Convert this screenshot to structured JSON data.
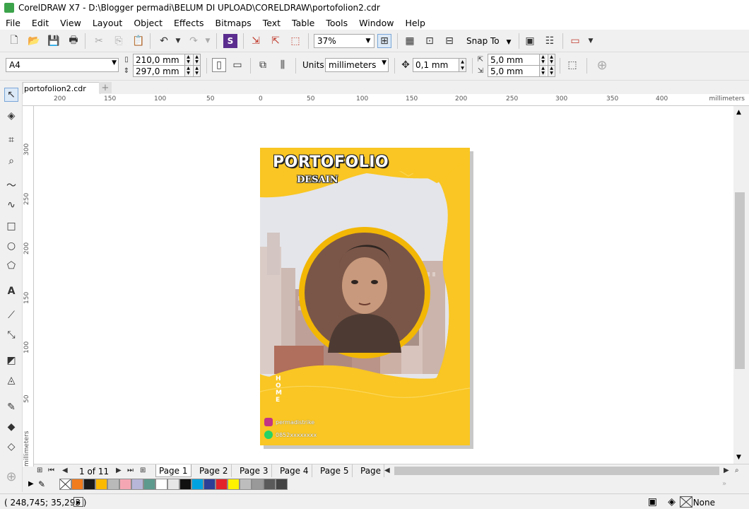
{
  "title_bar": {
    "app_title": "CorelDRAW X7 - D:\\Blogger permadi\\BELUM DI UPLOAD\\CORELDRAW\\portofolion2.cdr"
  },
  "menu": [
    "File",
    "Edit",
    "View",
    "Layout",
    "Object",
    "Effects",
    "Bitmaps",
    "Text",
    "Table",
    "Tools",
    "Window",
    "Help"
  ],
  "toolbar": {
    "zoom": "37%",
    "snap_to": "Snap To"
  },
  "property_bar": {
    "paper_size": "A4",
    "width": "210,0 mm",
    "height": "297,0 mm",
    "units_label": "Units:",
    "units": "millimeters",
    "nudge": "0,1 mm",
    "dup_x": "5,0 mm",
    "dup_y": "5,0 mm"
  },
  "document_tab": {
    "name": "portofolion2.cdr"
  },
  "ruler": {
    "h_ticks": [
      "200",
      "150",
      "100",
      "50",
      "0",
      "50",
      "100",
      "150",
      "200",
      "250",
      "300",
      "350",
      "400"
    ],
    "h_unit": "millimeters",
    "v_ticks": [
      "300",
      "250",
      "200",
      "150",
      "100",
      "50"
    ],
    "v_unit": "millimeters"
  },
  "poster": {
    "title": "PORTOFOLIO",
    "subtitle": "DESAIN",
    "side_text": "HOME",
    "instagram": "permadistrike",
    "whatsapp": "0852xxxxxxxx",
    "colors": {
      "yellow": "#f9c623",
      "sky": "#e8eaee",
      "accent": "#f2b705"
    }
  },
  "page_nav": {
    "counter": "1 of 11",
    "tabs": [
      "Page 1",
      "Page 2",
      "Page 3",
      "Page 4",
      "Page 5",
      "Page"
    ]
  },
  "palette": [
    "#ffffff",
    "#f07c1e",
    "#1a1a1a",
    "#fbb900",
    "#b9b9b9",
    "#f4a7b3",
    "#b7b6d8",
    "#5e9a8e",
    "#ffffff",
    "#e6e6e6",
    "#111111",
    "#00a3e0",
    "#2c3e96",
    "#e2232a",
    "#fff200",
    "#bdbdbd",
    "#999999",
    "#5a5a5a",
    "#444444"
  ],
  "status": {
    "coordinates": "( 248,745; 35,293 )",
    "fill": "None"
  }
}
